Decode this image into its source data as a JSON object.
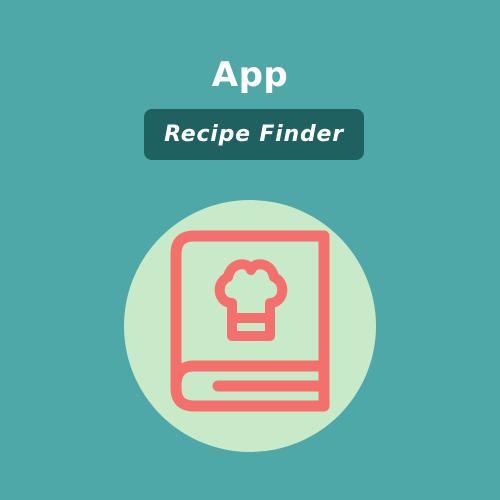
{
  "app_card": {
    "title": "App",
    "subtitle": "Recipe Finder",
    "illustration_icon": "cookbook-chef-hat-icon"
  },
  "colors": {
    "background": "#4fa8a8",
    "pill": "#1e6160",
    "circle": "#c8eac8",
    "book_outline": "#f56f6c",
    "text": "#ffffff"
  }
}
